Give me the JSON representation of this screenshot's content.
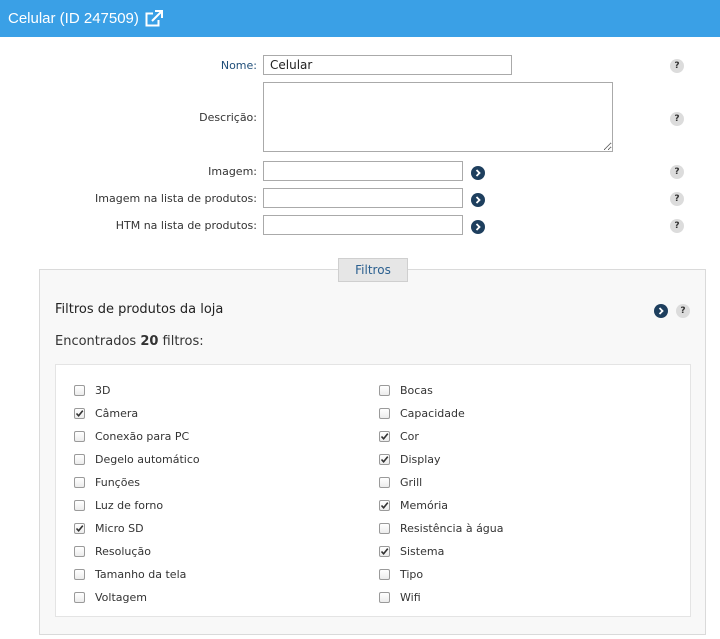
{
  "header": {
    "title": "Celular (ID 247509)"
  },
  "form": {
    "nome_label": "Nome:",
    "nome_value": "Celular",
    "descricao_label": "Descrição:",
    "imagem_label": "Imagem:",
    "imagem_lista_label": "Imagem na lista de produtos:",
    "htm_lista_label": "HTM na lista de produtos:"
  },
  "help_glyph": "?",
  "filtros": {
    "legend": "Filtros",
    "section_title": "Filtros de produtos da loja",
    "found_prefix": "Encontrados ",
    "found_count": "20",
    "found_suffix": " filtros:",
    "items": [
      {
        "label": "3D",
        "checked": false
      },
      {
        "label": "Câmera",
        "checked": true
      },
      {
        "label": "Conexão para PC",
        "checked": false
      },
      {
        "label": "Degelo automático",
        "checked": false
      },
      {
        "label": "Funções",
        "checked": false
      },
      {
        "label": "Luz de forno",
        "checked": false
      },
      {
        "label": "Micro SD",
        "checked": true
      },
      {
        "label": "Resolução",
        "checked": false
      },
      {
        "label": "Tamanho da tela",
        "checked": false
      },
      {
        "label": "Voltagem",
        "checked": false
      },
      {
        "label": "Bocas",
        "checked": false
      },
      {
        "label": "Capacidade",
        "checked": false
      },
      {
        "label": "Cor",
        "checked": true
      },
      {
        "label": "Display",
        "checked": true
      },
      {
        "label": "Grill",
        "checked": false
      },
      {
        "label": "Memória",
        "checked": true
      },
      {
        "label": "Resistência à água",
        "checked": false
      },
      {
        "label": "Sistema",
        "checked": true
      },
      {
        "label": "Tipo",
        "checked": false
      },
      {
        "label": "Wifi",
        "checked": false
      }
    ]
  },
  "colors": {
    "header_bg": "#3aa0e6",
    "go_button": "#1e3f5e",
    "help_bg": "#dcdcdc",
    "label_accent": "#1f4e79"
  }
}
